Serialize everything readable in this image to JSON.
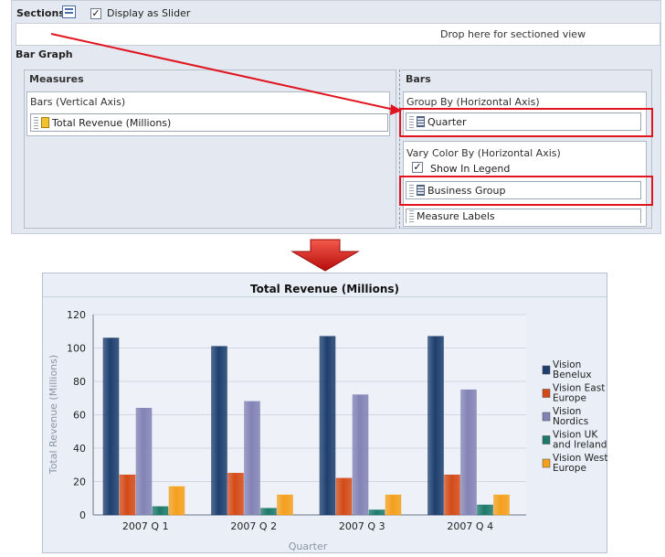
{
  "editor": {
    "sections_label": "Sections",
    "display_as_slider_label": "Display as Slider",
    "display_as_slider_checked": true,
    "dropzone_text": "Drop here for sectioned view",
    "bar_graph_label": "Bar Graph",
    "measures": {
      "title": "Measures",
      "bars_axis_label": "Bars (Vertical Axis)",
      "item": "Total Revenue (Millions)"
    },
    "bars": {
      "title": "Bars",
      "group_by_label": "Group By (Horizontal Axis)",
      "group_by_item": "Quarter",
      "vary_color_label": "Vary Color By (Horizontal Axis)",
      "show_in_legend_label": "Show In Legend",
      "show_in_legend_checked": true,
      "vary_color_item": "Business Group",
      "measure_labels_item": "Measure Labels"
    },
    "annotation_color": "#e0151f"
  },
  "chart_data": {
    "type": "bar",
    "title": "Total Revenue (Millions)",
    "xlabel": "Quarter",
    "ylabel": "Total Revenue (Millions)",
    "categories": [
      "2007 Q 1",
      "2007 Q 2",
      "2007 Q 3",
      "2007 Q 4"
    ],
    "ylim": [
      0,
      120
    ],
    "yticks": [
      0,
      20,
      40,
      60,
      80,
      100,
      120
    ],
    "grid": true,
    "legend_position": "right",
    "series": [
      {
        "name": "Vision Benelux",
        "values": [
          106,
          101,
          107,
          107
        ],
        "color": "#1e3f6e"
      },
      {
        "name": "Vision East Europe",
        "values": [
          24,
          25,
          22,
          24
        ],
        "color": "#d44a17"
      },
      {
        "name": "Vision Nordics",
        "values": [
          64,
          68,
          72,
          75
        ],
        "color": "#8283b5"
      },
      {
        "name": "Vision UK and Ireland",
        "values": [
          5,
          4,
          3,
          6
        ],
        "color": "#1d7a6b"
      },
      {
        "name": "Vision West Europe",
        "values": [
          17,
          12,
          12,
          12
        ],
        "color": "#f5a01c"
      }
    ],
    "legend_lines": [
      [
        "Vision",
        "Benelux"
      ],
      [
        "Vision East",
        "Europe"
      ],
      [
        "Vision",
        "Nordics"
      ],
      [
        "Vision UK",
        "and Ireland"
      ],
      [
        "Vision West",
        "Europe"
      ]
    ]
  }
}
